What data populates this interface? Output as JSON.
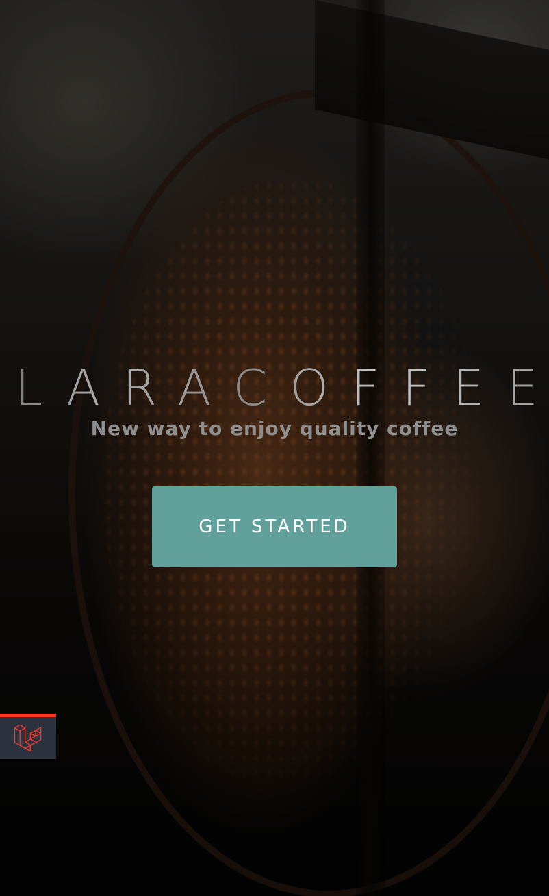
{
  "hero": {
    "title": "LARACOFFEE",
    "tagline": "New way to enjoy quality coffee",
    "cta_label": "GET STARTED",
    "background_image": "coffee beans in roaster drum"
  },
  "badge": {
    "icon": "laravel-logo-icon",
    "accent_color": "#ef3b2d",
    "background_color": "#2c313e"
  },
  "colors": {
    "button": "#62a09b",
    "button_text": "#ffffff",
    "tagline": "#8f8f8f",
    "title": "#a0a0a0"
  }
}
